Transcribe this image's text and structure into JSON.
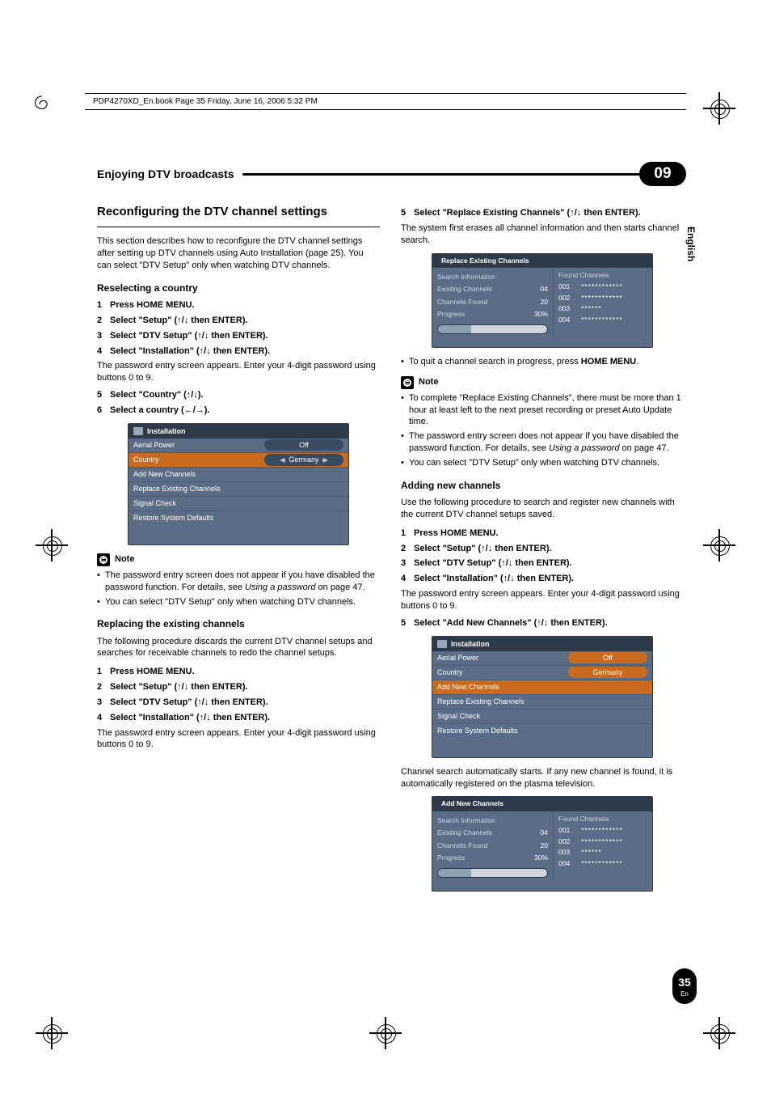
{
  "book_header": "PDP4270XD_En.book  Page 35  Friday, June 16, 2006  5:32 PM",
  "chapter": {
    "title": "Enjoying DTV broadcasts",
    "number": "09"
  },
  "lang_tab": "English",
  "page_num": "35",
  "page_lang": "En",
  "left": {
    "h2": "Reconfiguring the DTV channel settings",
    "intro": "This section describes how to reconfigure the DTV channel settings after setting up DTV channels using Auto Installation (page 25). You can select \"DTV Setup\" only when watching DTV channels.",
    "s1": {
      "h3": "Reselecting a country",
      "steps": {
        "1": "Press HOME MENU.",
        "2": "Select \"Setup\" (↑/↓ then ENTER).",
        "3": "Select \"DTV Setup\" (↑/↓ then ENTER).",
        "4": "Select \"Installation\" (↑/↓ then ENTER).",
        "after4": "The password entry screen appears. Enter your 4-digit password using buttons 0 to 9.",
        "5": "Select  \"Country\" (↑/↓).",
        "6": "Select a country (←/→)."
      },
      "menu": {
        "title": "Installation",
        "aerial": "Aerial Power",
        "aerial_val": "Off",
        "country": "Country",
        "country_val": "Germany",
        "add": "Add New Channels",
        "replace": "Replace Existing Channels",
        "signal": "Signal Check",
        "restore": "Restore System Defaults"
      },
      "note_label": "Note",
      "notes": [
        "The password entry screen does not appear if you have disabled the password function. For details, see Using a password on page 47.",
        "You can select \"DTV Setup\" only when watching DTV channels."
      ]
    },
    "s2": {
      "h3": "Replacing the existing channels",
      "intro": "The following procedure discards the current DTV channel setups and searches for receivable channels to redo the channel setups.",
      "steps": {
        "1": "Press HOME MENU.",
        "2": "Select \"Setup\" (↑/↓ then ENTER).",
        "3": "Select \"DTV Setup\" (↑/↓ then ENTER).",
        "4": "Select \"Installation\" (↑/↓ then ENTER).",
        "after4": "The password entry screen appears. Enter your 4-digit password using buttons 0 to 9."
      }
    }
  },
  "right": {
    "step5": "Select \"Replace Existing Channels\" (↑/↓ then ENTER).",
    "step5_after": "The system first erases all channel information and then starts channel search.",
    "search1": {
      "title": "Replace Existing Channels",
      "left_header": "Search Information",
      "rows": {
        "existing": {
          "k": "Existing Channels",
          "v": "04"
        },
        "found": {
          "k": "Channels Found",
          "v": "20"
        },
        "progress": {
          "k": "Progress",
          "v": "30%"
        }
      },
      "right_header": "Found Channels",
      "ch": [
        {
          "n": "001",
          "s": "************"
        },
        {
          "n": "002",
          "s": "************"
        },
        {
          "n": "003",
          "s": "******"
        },
        {
          "n": "004",
          "s": "************"
        }
      ]
    },
    "quit": "To quit a channel search in progress, press HOME MENU.",
    "note_label": "Note",
    "notes": [
      "To complete \"Replace Existing Channels\", there must be more than 1 hour at least left to the next preset recording or preset Auto Update time.",
      "The password entry screen does not appear if you have disabled the password function. For details, see Using a password on page 47.",
      "You can select \"DTV Setup\" only when watching DTV channels."
    ],
    "s3": {
      "h3": "Adding new channels",
      "intro": "Use the following procedure to search and register new channels with the current DTV channel setups saved.",
      "steps": {
        "1": "Press HOME MENU.",
        "2": "Select \"Setup\" (↑/↓ then ENTER).",
        "3": "Select \"DTV Setup\" (↑/↓ then ENTER).",
        "4": "Select \"Installation\" (↑/↓ then ENTER).",
        "after4": "The password entry screen appears. Enter your 4-digit password using buttons 0 to 9.",
        "5": "Select  \"Add New Channels\" (↑/↓ then ENTER)."
      },
      "menu": {
        "title": "Installation",
        "aerial": "Aerial Power",
        "aerial_val": "Off",
        "country": "Country",
        "country_val": "Germany",
        "add": "Add New Channels",
        "replace": "Replace Existing Channels",
        "signal": "Signal Check",
        "restore": "Restore System Defaults"
      },
      "outro": "Channel search automatically starts. If any new channel is found, it is automatically registered on the plasma television.",
      "search2": {
        "title": "Add New Channels",
        "left_header": "Search Information",
        "rows": {
          "existing": {
            "k": "Existing Channels",
            "v": "04"
          },
          "found": {
            "k": "Channels Found",
            "v": "20"
          },
          "progress": {
            "k": "Progress",
            "v": "30%"
          }
        },
        "right_header": "Found Channels",
        "ch": [
          {
            "n": "001",
            "s": "************"
          },
          {
            "n": "002",
            "s": "************"
          },
          {
            "n": "003",
            "s": "******"
          },
          {
            "n": "004",
            "s": "************"
          }
        ]
      }
    }
  }
}
